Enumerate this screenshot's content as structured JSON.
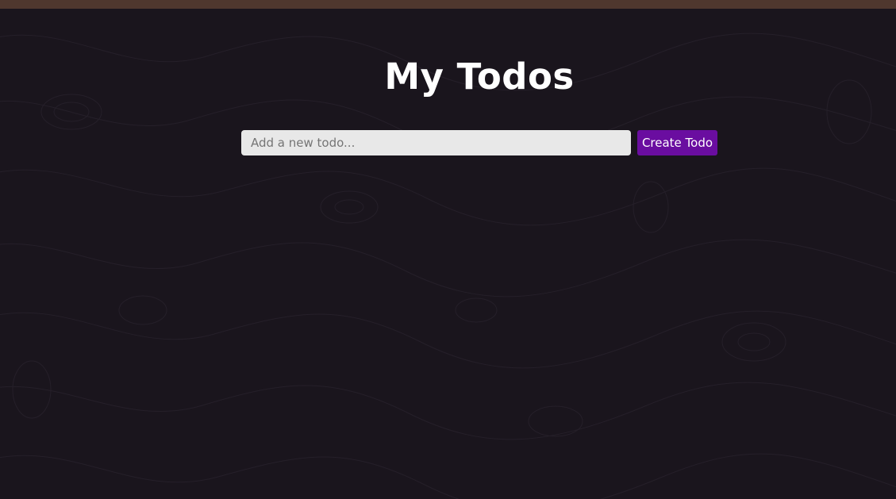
{
  "app": {
    "title": "My Todos"
  },
  "form": {
    "input_placeholder": "Add a new todo...",
    "input_value": "",
    "create_label": "Create Todo"
  },
  "colors": {
    "background": "#1a151d",
    "top_bar": "#4f372e",
    "accent": "#6a0da0",
    "input_bg": "#e8e8e8",
    "title_text": "#ffffff"
  }
}
